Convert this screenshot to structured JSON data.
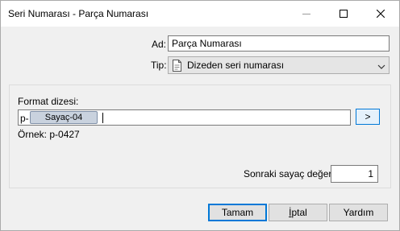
{
  "window": {
    "title": "Seri Numarası - Parça Numarası"
  },
  "fields": {
    "name_label": "Ad:",
    "name_value": "Parça Numarası",
    "type_label": "Tip:",
    "type_value": "Dizeden seri numarası"
  },
  "format": {
    "label": "Format dizesi:",
    "prefix": "p-",
    "token": "Sayaç-04",
    "insert_button": ">",
    "example_label": "Örnek: p-0427"
  },
  "counter": {
    "label": "Sonraki sayaç değeri:",
    "value": "1"
  },
  "buttons": {
    "ok": "Tamam",
    "cancel_first": "İ",
    "cancel_rest": "ptal",
    "help": "Yardım"
  },
  "icons": {
    "minimize": "minimize-icon",
    "maximize": "maximize-icon",
    "close": "close-icon",
    "type": "document-icon",
    "dropdown": "chevron-down-icon"
  }
}
